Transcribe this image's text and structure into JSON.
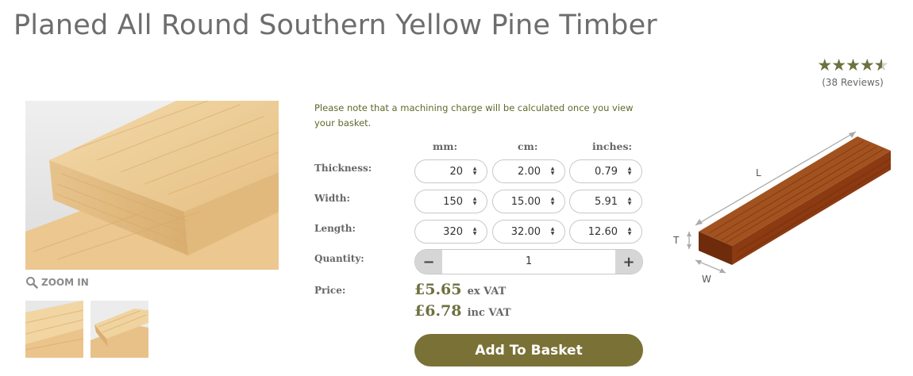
{
  "product": {
    "title": "Planed All Round Southern Yellow Pine Timber",
    "rating": 4.5,
    "reviews_label": "(38 Reviews)"
  },
  "gallery": {
    "zoom_label": "ZOOM IN"
  },
  "configurator": {
    "note": "Please note that a machining charge will be calculated once you view your basket.",
    "columns": {
      "mm": "mm:",
      "cm": "cm:",
      "inches": "inches:"
    },
    "thickness": {
      "label": "Thickness:",
      "mm": "20",
      "cm": "2.00",
      "inches": "0.79"
    },
    "width": {
      "label": "Width:",
      "mm": "150",
      "cm": "15.00",
      "inches": "5.91"
    },
    "length": {
      "label": "Length:",
      "mm": "320",
      "cm": "32.00",
      "inches": "12.60"
    },
    "quantity": {
      "label": "Quantity:",
      "value": "1",
      "minus": "−",
      "plus": "+"
    },
    "price": {
      "label": "Price:",
      "ex_vat_amount": "£5.65",
      "ex_vat_label": "ex VAT",
      "inc_vat_amount": "£6.78",
      "inc_vat_label": "inc VAT"
    },
    "add_to_basket": "Add To Basket"
  },
  "diagram": {
    "length_label": "L",
    "thickness_label": "T",
    "width_label": "W"
  },
  "colors": {
    "accent": "#7a7136",
    "star": "#6e7140",
    "note_text": "#5c6b2a",
    "timber_diagram": "#8b3a12"
  },
  "icons": {
    "zoom": "magnifier-icon",
    "stepper": "up-down-arrows-icon"
  }
}
